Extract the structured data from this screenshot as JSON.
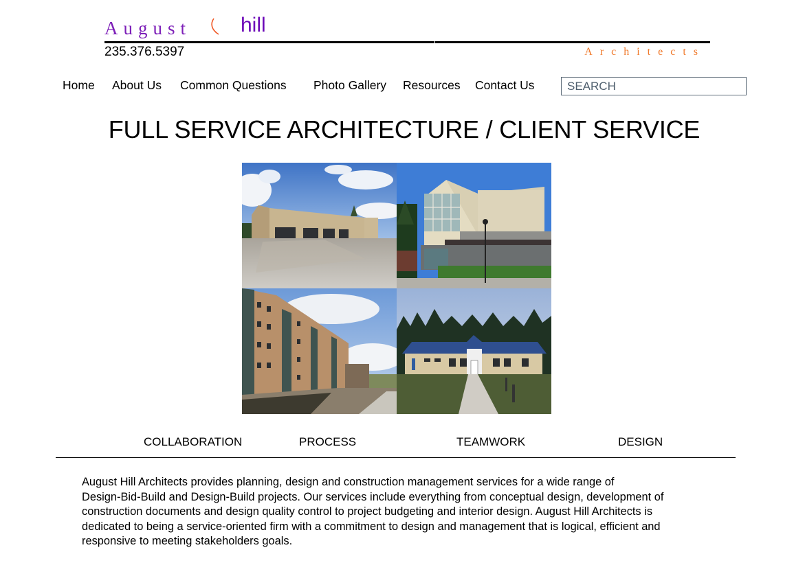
{
  "header": {
    "logo": {
      "word_1": "August",
      "word_2": "hill",
      "tagline": "Architects",
      "colors": {
        "august": "#7d1fb8",
        "hill": "#6d0ab8",
        "arc": "#f05a28",
        "tagline": "#f07a2c"
      }
    },
    "phone": "235.376.5397"
  },
  "nav": {
    "items": [
      {
        "label": "Home"
      },
      {
        "label": "About Us"
      },
      {
        "label": "Common Questions"
      },
      {
        "label": "Photo Gallery"
      },
      {
        "label": "Resources"
      },
      {
        "label": "Contact Us"
      }
    ],
    "search": {
      "placeholder": "SEARCH",
      "value": ""
    }
  },
  "main": {
    "headline": "FULL SERVICE ARCHITECTURE / CLIENT SERVICE",
    "photos": [
      {
        "subject": "Large maintenance facility with four garage bays and wet concrete apron"
      },
      {
        "subject": "Two-story civic building with glass stair tower and landscaped entry"
      },
      {
        "subject": "Four-story brick residential buildings with landscaped grounds"
      },
      {
        "subject": "Single-story building with blue metal roof and central walkway"
      }
    ],
    "pillars": [
      "COLLABORATION",
      "PROCESS",
      "TEAMWORK",
      "DESIGN"
    ],
    "body_lines": [
      "August Hill Architects provides planning, design and construction management services for a wide range of",
      "Design-Bid-Build and Design-Build projects.  Our services include everything from conceptual design, development of",
      "construction documents and design quality control to project budgeting and interior design.  August Hill Architects is",
      "dedicated to being a service-oriented firm with a commitment to design and management that is logical, efficient and",
      "responsive to meeting stakeholders goals."
    ]
  }
}
